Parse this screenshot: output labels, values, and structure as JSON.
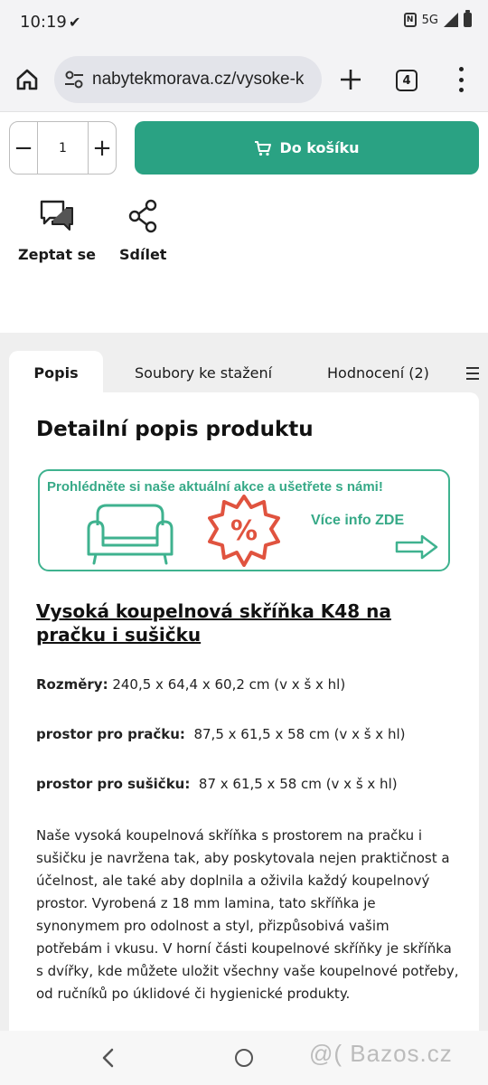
{
  "status_bar": {
    "time": "10:19",
    "network": "5G"
  },
  "browser": {
    "url": "nabytekmorava.cz/vysoke-k",
    "tab_count": "4"
  },
  "purchase": {
    "quantity": "1",
    "cart_label": "Do košíku",
    "minus": "−",
    "plus": "+"
  },
  "actions": {
    "ask_label": "Zeptat se",
    "share_label": "Sdílet"
  },
  "tabs": [
    "Popis",
    "Soubory ke stažení",
    "Hodnocení (2)"
  ],
  "content": {
    "heading": "Detailní popis produktu",
    "promo": {
      "headline": "Prohlédněte si naše aktuální akce a ušetřete s námi!",
      "info": "Více info ZDE",
      "badge": "%"
    },
    "product_title": "Vysoká koupelnová skříňka K48 na pračku i sušičku",
    "specs": [
      {
        "label": "Rozměry:",
        "value": " 240,5 x 64,4 x 60,2 cm (v x š x hl)"
      },
      {
        "label": "prostor pro pračku:",
        "value": "  87,5 x 61,5 x 58 cm (v x š x hl)"
      },
      {
        "label": "prostor pro sušičku:",
        "value": "  87 x 61,5 x 58 cm (v x š x hl)"
      }
    ],
    "description": "Naše vysoká koupelnová skříňka s prostorem na pračku i sušičku je navržena tak, aby poskytovala nejen praktičnost a účelnost, ale také aby doplnila a oživila každý koupelnový prostor. Vyrobená z 18 mm lamina, tato skříňka je synonymem pro odolnost a styl, přizpůsobivá vašim potřebám i vkusu. V horní části koupelnové skříňky je skříňka s dvířky, kde můžete uložit všechny vaše koupelnové potřeby, od ručníků po úklidové či hygienické produkty."
  },
  "watermark": "@( Bazos.cz",
  "colors": {
    "accent": "#2aa283",
    "promo_green": "#3fb28f",
    "promo_red": "#e0533f"
  }
}
